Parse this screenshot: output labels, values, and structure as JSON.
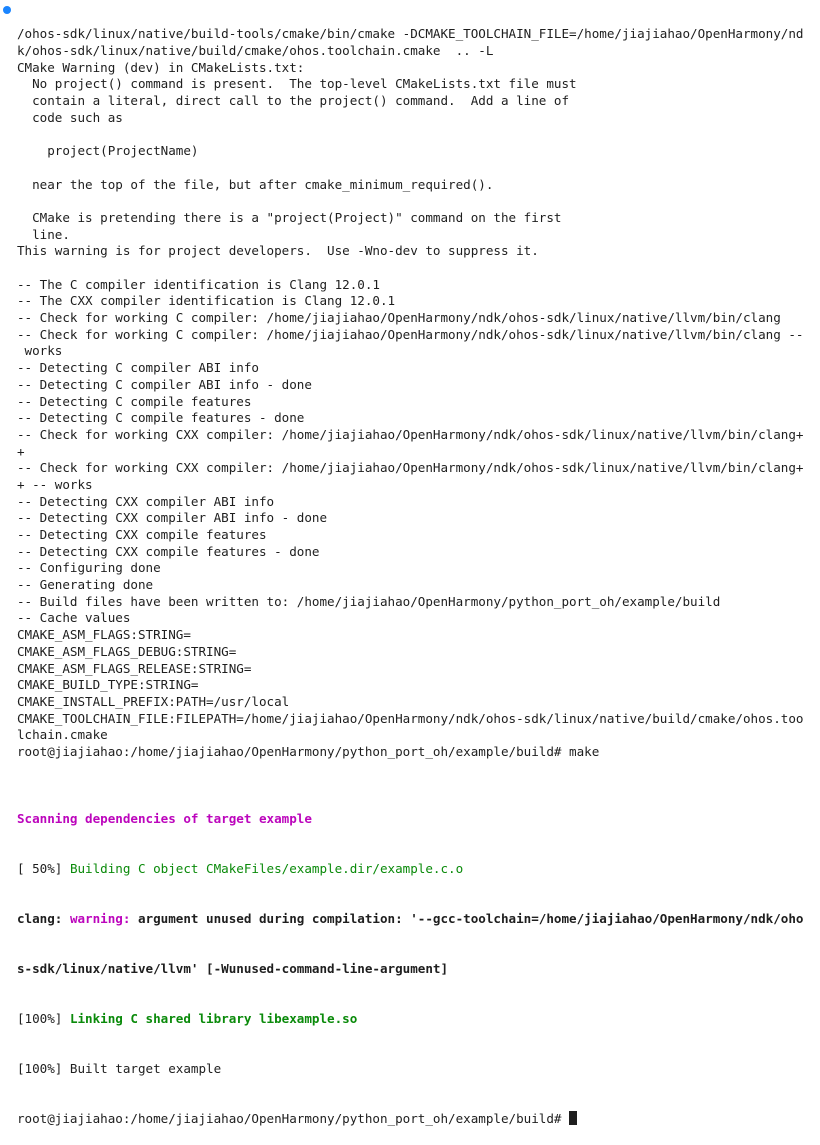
{
  "terminal": {
    "status_dot_color": "#1a85ff",
    "lines": [
      "/ohos-sdk/linux/native/build-tools/cmake/bin/cmake -DCMAKE_TOOLCHAIN_FILE=/home/jiajiahao/OpenHarmony/nd",
      "k/ohos-sdk/linux/native/build/cmake/ohos.toolchain.cmake  .. -L",
      "CMake Warning (dev) in CMakeLists.txt:",
      "  No project() command is present.  The top-level CMakeLists.txt file must",
      "  contain a literal, direct call to the project() command.  Add a line of",
      "  code such as",
      "",
      "    project(ProjectName)",
      "",
      "  near the top of the file, but after cmake_minimum_required().",
      "",
      "  CMake is pretending there is a \"project(Project)\" command on the first",
      "  line.",
      "This warning is for project developers.  Use -Wno-dev to suppress it.",
      "",
      "-- The C compiler identification is Clang 12.0.1",
      "-- The CXX compiler identification is Clang 12.0.1",
      "-- Check for working C compiler: /home/jiajiahao/OpenHarmony/ndk/ohos-sdk/linux/native/llvm/bin/clang",
      "-- Check for working C compiler: /home/jiajiahao/OpenHarmony/ndk/ohos-sdk/linux/native/llvm/bin/clang --",
      " works",
      "-- Detecting C compiler ABI info",
      "-- Detecting C compiler ABI info - done",
      "-- Detecting C compile features",
      "-- Detecting C compile features - done",
      "-- Check for working CXX compiler: /home/jiajiahao/OpenHarmony/ndk/ohos-sdk/linux/native/llvm/bin/clang+",
      "+",
      "-- Check for working CXX compiler: /home/jiajiahao/OpenHarmony/ndk/ohos-sdk/linux/native/llvm/bin/clang+",
      "+ -- works",
      "-- Detecting CXX compiler ABI info",
      "-- Detecting CXX compiler ABI info - done",
      "-- Detecting CXX compile features",
      "-- Detecting CXX compile features - done",
      "-- Configuring done",
      "-- Generating done",
      "-- Build files have been written to: /home/jiajiahao/OpenHarmony/python_port_oh/example/build",
      "-- Cache values",
      "CMAKE_ASM_FLAGS:STRING=",
      "CMAKE_ASM_FLAGS_DEBUG:STRING=",
      "CMAKE_ASM_FLAGS_RELEASE:STRING=",
      "CMAKE_BUILD_TYPE:STRING=",
      "CMAKE_INSTALL_PREFIX:PATH=/usr/local",
      "CMAKE_TOOLCHAIN_FILE:FILEPATH=/home/jiajiahao/OpenHarmony/ndk/ohos-sdk/linux/native/build/cmake/ohos.too",
      "lchain.cmake",
      "root@jiajiahao:/home/jiajiahao/OpenHarmony/python_port_oh/example/build# make"
    ],
    "make_output": {
      "scanning": "Scanning dependencies of target example",
      "building_prefix": "[ 50%] ",
      "building_text": "Building C object CMakeFiles/example.dir/example.c.o",
      "clang_prefix": "clang: ",
      "clang_warning_label": "warning:",
      "clang_warning_text": " argument unused during compilation: '--gcc-toolchain=/home/jiajiahao/OpenHarmony/ndk/oho",
      "clang_warning_cont": "s-sdk/linux/native/llvm' [-Wunused-command-line-argument]",
      "linking_prefix": "[100%] ",
      "linking_text": "Linking C shared library libexample.so",
      "built": "[100%] Built target example",
      "prompt": "root@jiajiahao:/home/jiajiahao/OpenHarmony/python_port_oh/example/build# "
    }
  }
}
